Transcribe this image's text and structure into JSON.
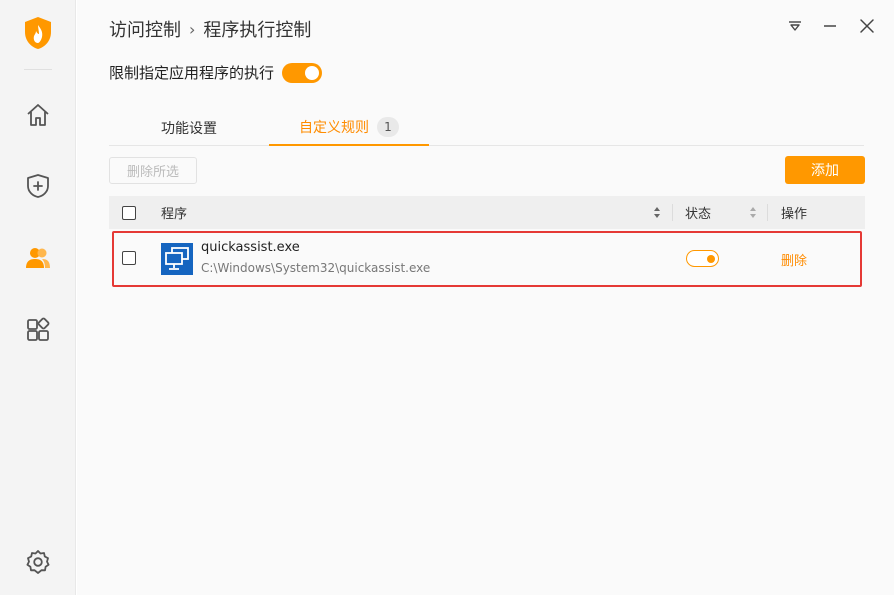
{
  "sidebar": {
    "logo": "shield-flame-logo",
    "items": [
      {
        "name": "home",
        "icon": "home-icon"
      },
      {
        "name": "protection",
        "icon": "shield-plus-icon"
      },
      {
        "name": "access-control",
        "icon": "users-icon",
        "active": true
      },
      {
        "name": "apps",
        "icon": "apps-grid-icon"
      }
    ],
    "settings_icon": "gear-icon"
  },
  "header": {
    "breadcrumb_parent": "访问控制",
    "breadcrumb_separator": "›",
    "breadcrumb_current": "程序执行控制",
    "controls": [
      "menu-icon",
      "minimize-icon",
      "close-icon"
    ]
  },
  "restrict": {
    "label": "限制指定应用程序的执行",
    "enabled": true
  },
  "tabs": [
    {
      "label": "功能设置"
    },
    {
      "label": "自定义规则",
      "badge": "1",
      "active": true
    }
  ],
  "toolbar": {
    "delete_selected_label": "删除所选",
    "add_label": "添加"
  },
  "table": {
    "headers": {
      "program": "程序",
      "status": "状态",
      "action": "操作"
    },
    "rows": [
      {
        "name": "quickassist.exe",
        "path": "C:\\Windows\\System32\\quickassist.exe",
        "enabled": true,
        "action_label": "删除"
      }
    ]
  },
  "colors": {
    "accent": "#ff9800",
    "highlight_border": "#e53935"
  }
}
